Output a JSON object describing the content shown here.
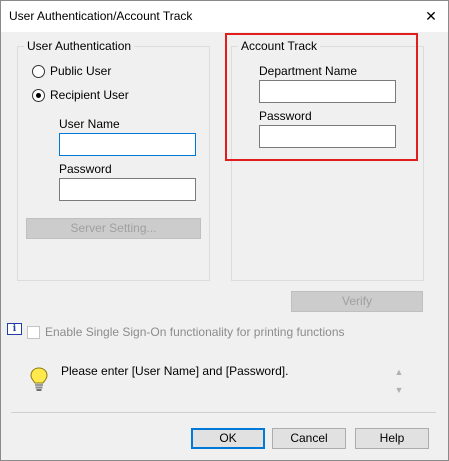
{
  "window": {
    "title": "User Authentication/Account Track",
    "close_glyph": "✕"
  },
  "user_auth": {
    "group_label": "User Authentication",
    "public_user_label": "Public User",
    "recipient_user_label": "Recipient User",
    "selected": "recipient",
    "user_name_label": "User Name",
    "user_name_value": "",
    "password_label": "Password",
    "password_value": "",
    "server_setting_label": "Server Setting..."
  },
  "account_track": {
    "group_label": "Account Track",
    "department_name_label": "Department Name",
    "department_name_value": "",
    "password_label": "Password",
    "password_value": "",
    "highlight_color": "#e11d1d"
  },
  "verify_label": "Verify",
  "sso": {
    "label": "Enable Single Sign-On functionality for printing functions",
    "checked": false,
    "info_icon_glyph": "i"
  },
  "message": {
    "text": "Please enter [User Name] and [Password].",
    "icon": "lightbulb-icon"
  },
  "buttons": {
    "ok": "OK",
    "cancel": "Cancel",
    "help": "Help"
  },
  "colors": {
    "focus": "#0078d7",
    "window_bg": "#f0f0f0"
  }
}
